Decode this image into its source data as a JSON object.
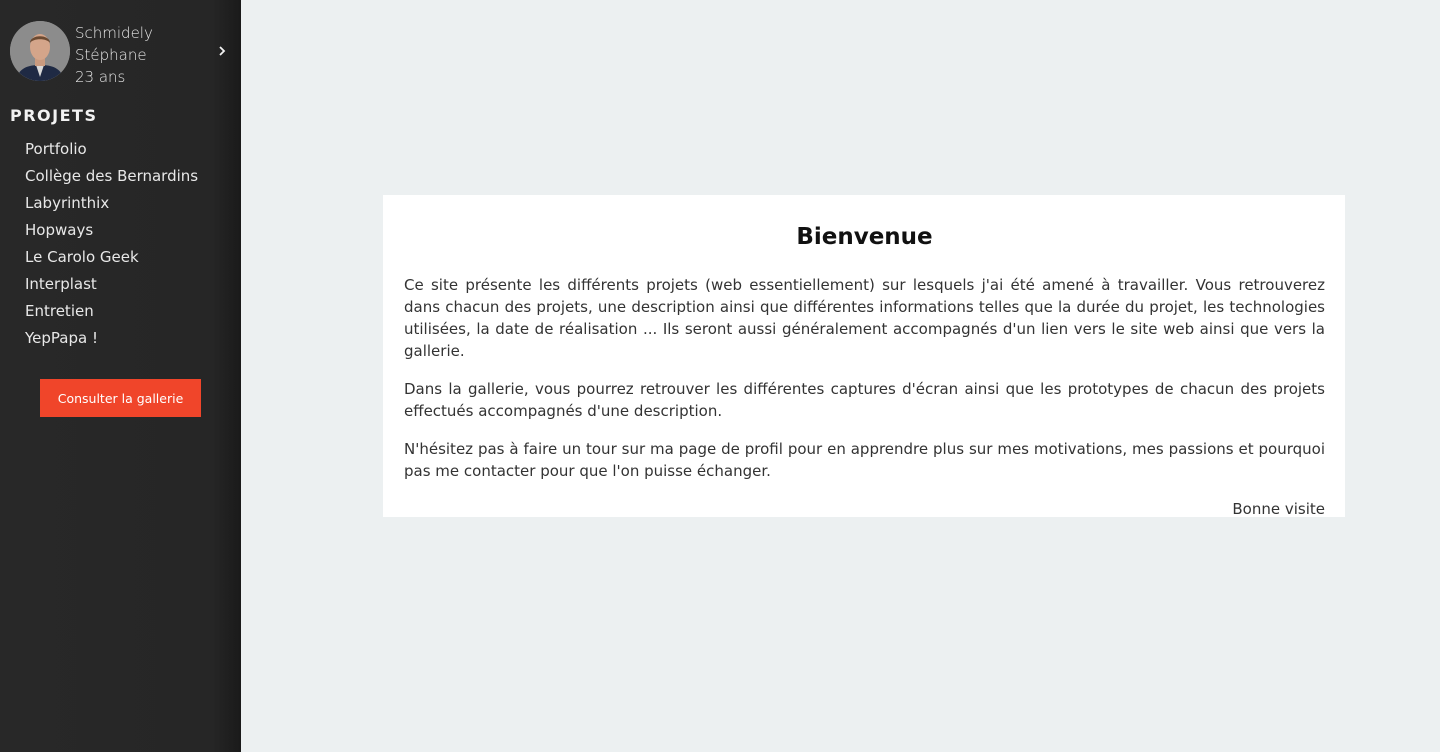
{
  "profile": {
    "first_line": "Schmidely",
    "second_line": "Stéphane",
    "age": "23 ans"
  },
  "sidebar": {
    "section_title": "PROJETS",
    "items": [
      {
        "label": "Portfolio"
      },
      {
        "label": "Collège des Bernardins"
      },
      {
        "label": "Labyrinthix"
      },
      {
        "label": "Hopways"
      },
      {
        "label": "Le Carolo Geek"
      },
      {
        "label": "Interplast"
      },
      {
        "label": "Entretien"
      },
      {
        "label": "YepPapa !"
      }
    ],
    "gallery_button": "Consulter la gallerie"
  },
  "main": {
    "title": "Bienvenue",
    "paragraphs": [
      "Ce site présente les différents projets (web essentiellement) sur lesquels j'ai été amené à travailler. Vous retrouverez dans chacun des projets, une description ainsi que différentes informations telles que la durée du projet, les technologies utilisées, la date de réalisation ... Ils seront aussi généralement accompagnés d'un lien vers le site web ainsi que vers la gallerie.",
      "Dans la gallerie, vous pourrez retrouver les différentes captures d'écran ainsi que les prototypes de chacun des projets effectués accompagnés d'une description.",
      "N'hésitez pas à faire un tour sur ma page de profil pour en apprendre plus sur mes motivations, mes passions et pourquoi pas me contacter pour que l'on puisse échanger."
    ],
    "signoff": "Bonne visite"
  },
  "colors": {
    "sidebar_bg": "#262626",
    "page_bg": "#ecf0f1",
    "accent": "#f0452a",
    "card_bg": "#ffffff"
  },
  "icons": {
    "profile_arrow": "chevron-right-icon"
  }
}
